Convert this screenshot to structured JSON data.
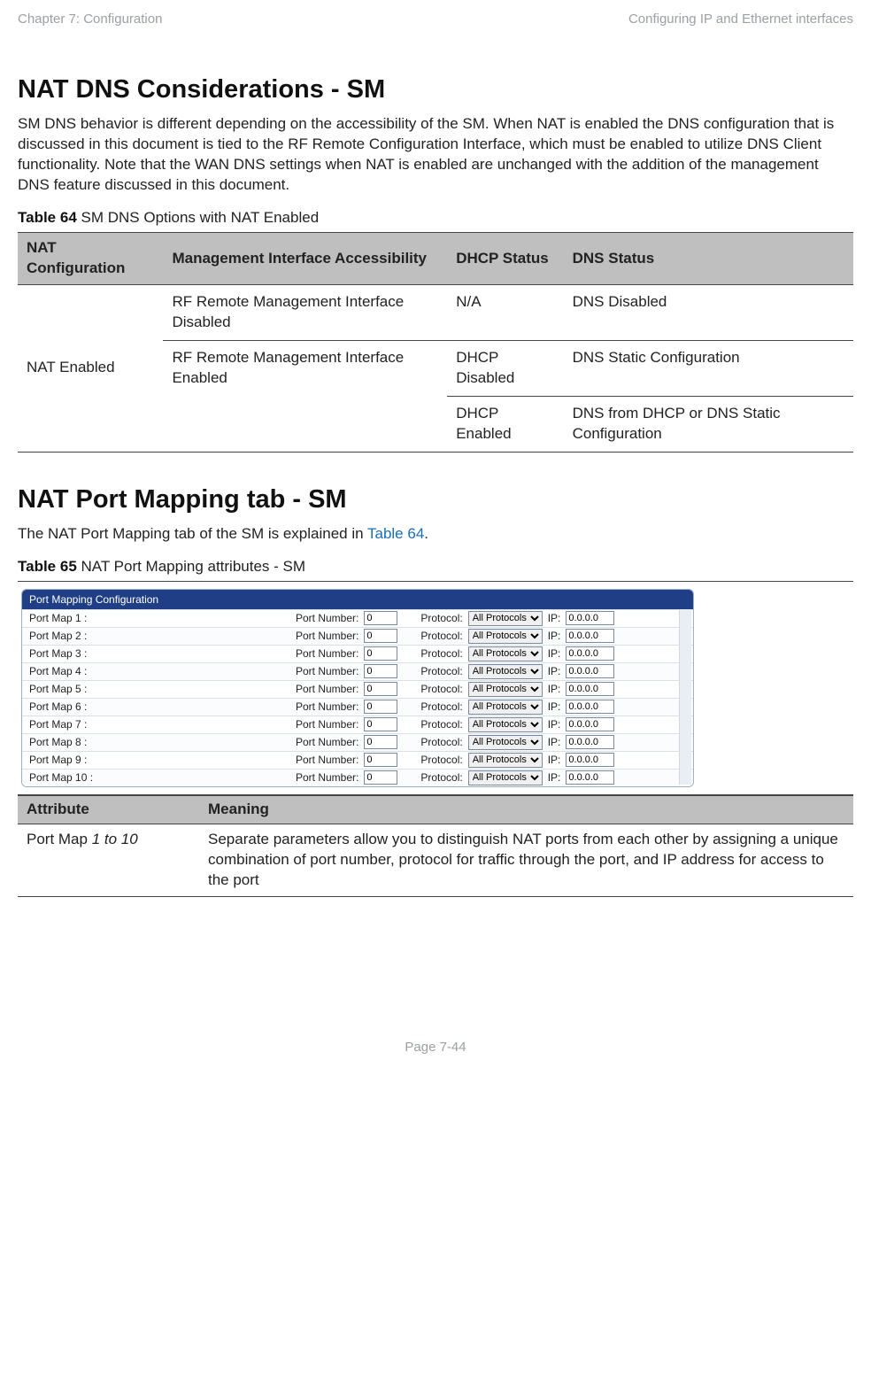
{
  "header": {
    "left": "Chapter 7:  Configuration",
    "right": "Configuring IP and Ethernet interfaces"
  },
  "section1": {
    "title": "NAT DNS Considerations - SM",
    "body": "SM DNS behavior is different depending on the accessibility of the SM. When NAT is enabled the DNS configuration that is discussed in this document is tied to the RF Remote Configuration Interface, which must be enabled to utilize DNS Client functionality. Note that the WAN DNS settings when NAT is enabled are unchanged with the addition of the management DNS feature discussed in this document."
  },
  "table64": {
    "caption_bold": "Table 64",
    "caption_rest": " SM DNS Options with NAT Enabled",
    "headers": [
      "NAT Configuration",
      "Management Interface Accessibility",
      "DHCP Status",
      "DNS Status"
    ],
    "rows": {
      "nat_enabled": "NAT Enabled",
      "mgmt_disabled": "RF Remote Management Interface Disabled",
      "mgmt_enabled": "RF Remote Management Interface Enabled",
      "na": "N/A",
      "dns_disabled": "DNS Disabled",
      "dhcp_disabled": "DHCP Disabled",
      "dns_static": "DNS Static Configuration",
      "dhcp_enabled": "DHCP Enabled",
      "dns_from_dhcp": "DNS from DHCP or DNS Static Configuration"
    }
  },
  "section2": {
    "title": "NAT Port Mapping tab - SM",
    "body_pre": "The NAT Port Mapping tab of the SM is explained in ",
    "body_link": "Table 64",
    "body_post": "."
  },
  "table65": {
    "caption_bold": "Table 65",
    "caption_rest": " NAT Port Mapping attributes - SM"
  },
  "port_mapping": {
    "panel_title": "Port Mapping Configuration",
    "labels": {
      "port_number": "Port Number:",
      "protocol": "Protocol:",
      "ip": "IP:",
      "protocol_value": "All Protocols",
      "port_value": "0",
      "ip_value": "0.0.0.0"
    },
    "rows": [
      "Port Map 1 :",
      "Port Map 2 :",
      "Port Map 3 :",
      "Port Map 4 :",
      "Port Map 5 :",
      "Port Map 6 :",
      "Port Map 7 :",
      "Port Map 8 :",
      "Port Map 9 :",
      "Port Map 10 :"
    ]
  },
  "attr_table": {
    "headers": [
      "Attribute",
      "Meaning"
    ],
    "row": {
      "attr_pre": "Port Map ",
      "attr_em": "1 to 10",
      "meaning": "Separate parameters allow you to distinguish NAT ports from each other by assigning a unique combination of port number, protocol for traffic through the port, and IP address for access to the port"
    }
  },
  "footer": "Page 7-44"
}
